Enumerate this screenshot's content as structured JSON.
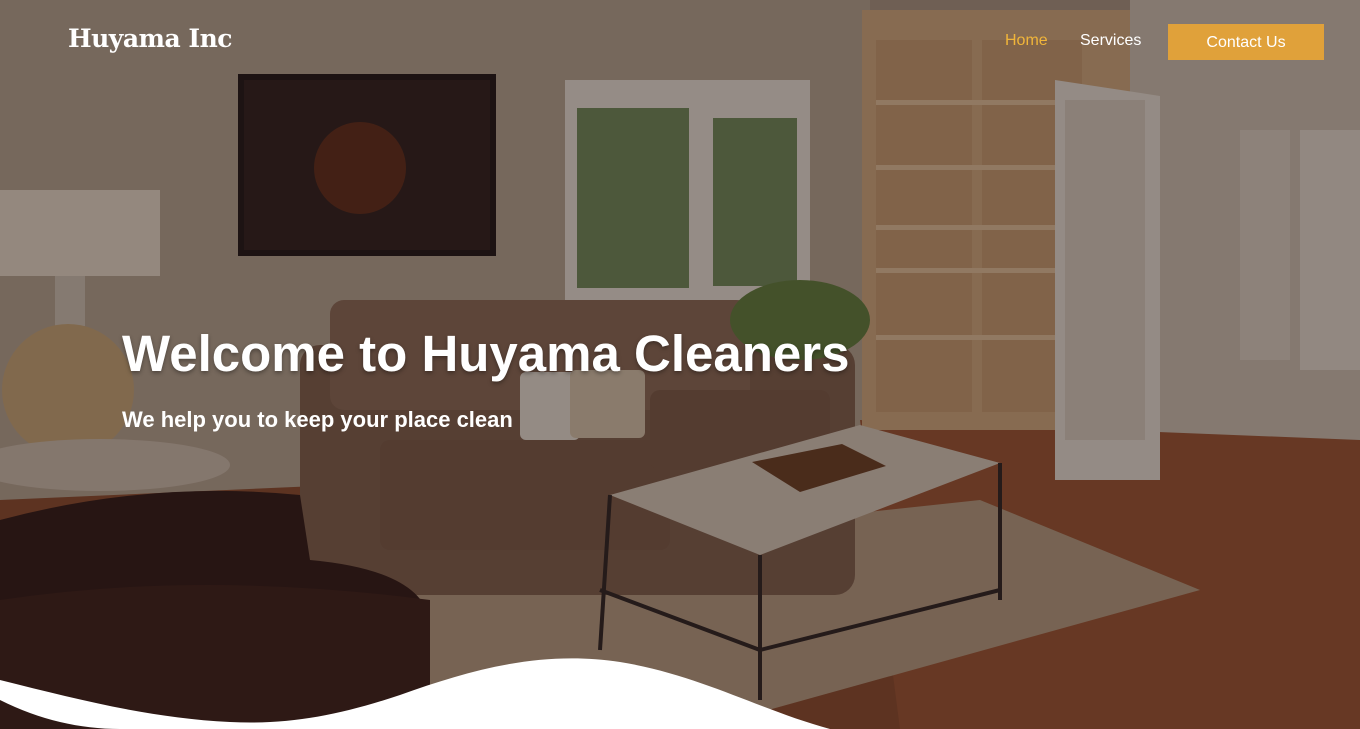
{
  "brand": {
    "name": "Huyama Inc"
  },
  "nav": {
    "links": [
      {
        "label": "Home",
        "active": true
      },
      {
        "label": "Services",
        "active": false
      }
    ],
    "cta_label": "Contact Us"
  },
  "hero": {
    "title": "Welcome to Huyama Cleaners",
    "subtitle": "We help you to keep your place clean",
    "background_image": "living-room-photo"
  },
  "colors": {
    "accent": "#e0a13a",
    "active_link": "#f0b53a",
    "text": "#ffffff"
  }
}
